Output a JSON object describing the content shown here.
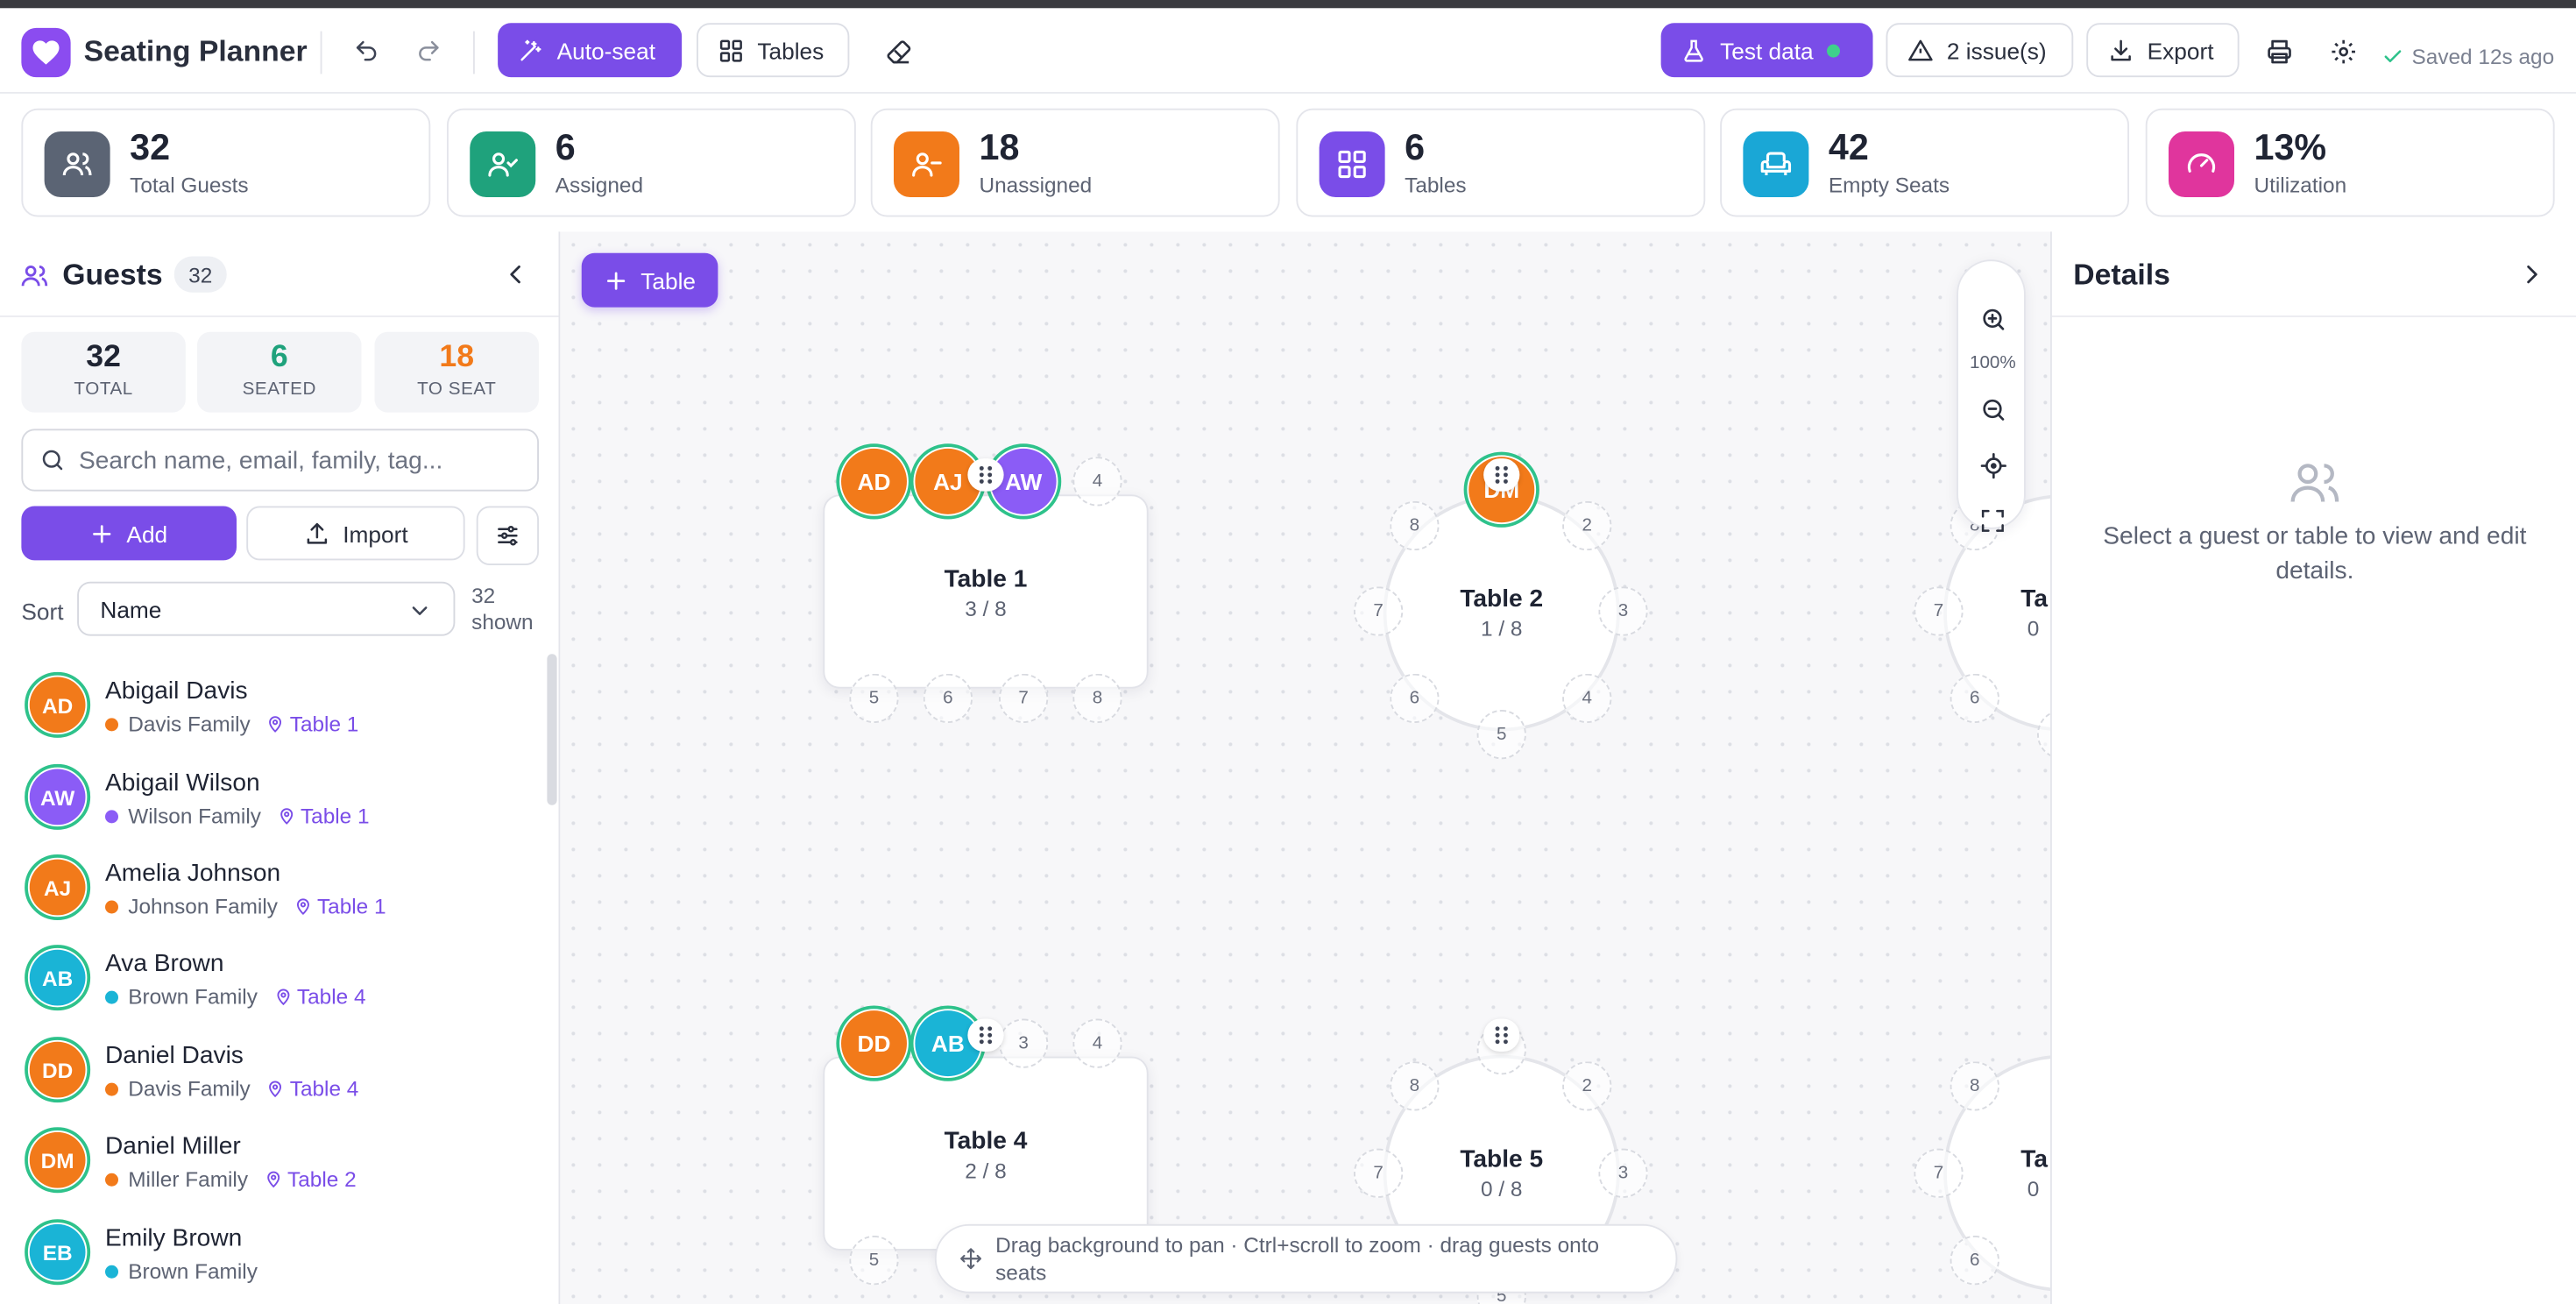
{
  "app": {
    "title": "Seating Planner",
    "saved_status": "Saved 12s ago",
    "accent": "#7a4de8"
  },
  "toolbar": {
    "autoseat_label": "Auto-seat",
    "tables_label": "Tables",
    "test_data_label": "Test data",
    "issues_label": "2 issue(s)",
    "export_label": "Export",
    "icons": [
      "undo-icon",
      "redo-icon",
      "eraser-icon",
      "print-icon",
      "settings-icon"
    ]
  },
  "stats": [
    {
      "value": "32",
      "label": "Total Guests",
      "color": "#5b6474",
      "icon": "users-icon"
    },
    {
      "value": "6",
      "label": "Assigned",
      "color": "#1fa27c",
      "icon": "user-check-icon"
    },
    {
      "value": "18",
      "label": "Unassigned",
      "color": "#f27a1a",
      "icon": "user-minus-icon"
    },
    {
      "value": "6",
      "label": "Tables",
      "color": "#7a4de8",
      "icon": "grid-icon"
    },
    {
      "value": "42",
      "label": "Empty Seats",
      "color": "#1aa7d6",
      "icon": "armchair-icon"
    },
    {
      "value": "13%",
      "label": "Utilization",
      "color": "#e0359d",
      "icon": "gauge-icon"
    }
  ],
  "guests_panel": {
    "title": "Guests",
    "count": "32",
    "mini_stats": [
      {
        "value": "32",
        "label": "TOTAL",
        "color": "#1f2433"
      },
      {
        "value": "6",
        "label": "SEATED",
        "color": "#1fa27c"
      },
      {
        "value": "18",
        "label": "TO SEAT",
        "color": "#f27a1a"
      }
    ],
    "search_placeholder": "Search name, email, family, tag...",
    "add_label": "Add",
    "import_label": "Import",
    "sort_label": "Sort",
    "sort_value": "Name",
    "shown_count": "32",
    "shown_label": "shown",
    "guests": [
      {
        "initials": "AD",
        "name": "Abigail Davis",
        "family": "Davis Family",
        "family_color": "#f27a1a",
        "avatar_color": "#f27a1a",
        "table": "Table 1"
      },
      {
        "initials": "AW",
        "name": "Abigail Wilson",
        "family": "Wilson Family",
        "family_color": "#8b5cf6",
        "avatar_color": "#8b5cf6",
        "table": "Table 1"
      },
      {
        "initials": "AJ",
        "name": "Amelia Johnson",
        "family": "Johnson Family",
        "family_color": "#f27a1a",
        "avatar_color": "#f27a1a",
        "table": "Table 1"
      },
      {
        "initials": "AB",
        "name": "Ava Brown",
        "family": "Brown Family",
        "family_color": "#1ab4d6",
        "avatar_color": "#1ab4d6",
        "table": "Table 4"
      },
      {
        "initials": "DD",
        "name": "Daniel Davis",
        "family": "Davis Family",
        "family_color": "#f27a1a",
        "avatar_color": "#f27a1a",
        "table": "Table 4"
      },
      {
        "initials": "DM",
        "name": "Daniel Miller",
        "family": "Miller Family",
        "family_color": "#f27a1a",
        "avatar_color": "#f27a1a",
        "table": "Table 2"
      },
      {
        "initials": "EB",
        "name": "Emily Brown",
        "family": "Brown Family",
        "family_color": "#1ab4d6",
        "avatar_color": "#1ab4d6",
        "table": ""
      }
    ]
  },
  "canvas": {
    "add_table_label": "Table",
    "zoom_level": "100%",
    "hint": "Drag background to pan · Ctrl+scroll to zoom · drag guests onto seats",
    "tables": [
      {
        "name": "Table 1",
        "count": "3 / 8"
      },
      {
        "name": "Table 2",
        "count": "1 / 8"
      },
      {
        "name": "Table 3",
        "name_visible": "Ta",
        "count_visible": "0"
      },
      {
        "name": "Table 4",
        "count": "2 / 8"
      },
      {
        "name": "Table 5",
        "count": "0 / 8"
      },
      {
        "name": "Table 6",
        "name_visible": "Ta",
        "count_visible": "0"
      }
    ]
  },
  "details": {
    "title": "Details",
    "empty_text": "Select a guest or table to view and edit details."
  }
}
